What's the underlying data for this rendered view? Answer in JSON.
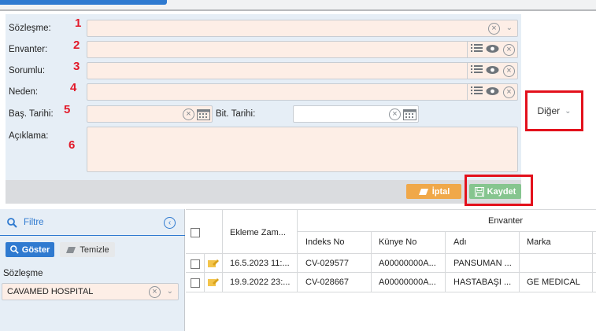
{
  "form": {
    "sozlesme_label": "Sözleşme:",
    "envanter_label": "Envanter:",
    "sorumlu_label": "Sorumlu:",
    "neden_label": "Neden:",
    "bas_tarihi_label": "Baş. Tarihi:",
    "bit_tarihi_label": "Bit. Tarihi:",
    "aciklama_label": "Açıklama:",
    "annotations": [
      "1",
      "2",
      "3",
      "4",
      "5",
      "6"
    ]
  },
  "actions": {
    "iptal_label": "İptal",
    "kaydet_label": "Kaydet"
  },
  "side": {
    "diger_label": "Diğer"
  },
  "filter": {
    "title": "Filtre",
    "goster_label": "Göster",
    "temizle_label": "Temizle",
    "sozlesme_label": "Sözleşme",
    "sozlesme_value": "CAVAMED HOSPITAL"
  },
  "grid": {
    "col_ekleme": "Ekleme Zam...",
    "group_envanter": "Envanter",
    "col_indeks": "Indeks No",
    "col_kunye": "Künye No",
    "col_adi": "Adı",
    "col_marka": "Marka",
    "rows": [
      {
        "ekleme": "16.5.2023 11:...",
        "indeks": "CV-029577",
        "kunye": "A00000000A...",
        "adi": "PANSUMAN ...",
        "marka": ""
      },
      {
        "ekleme": "19.9.2022 23:...",
        "indeks": "CV-028667",
        "kunye": "A00000000A...",
        "adi": "HASTABAŞI ...",
        "marka": "GE MEDICAL"
      }
    ]
  },
  "colors": {
    "accent": "#2f7ad0",
    "field_bg": "#fdeee6",
    "annotation_red": "#e21a2a",
    "iptal": "#f0a849",
    "kaydet": "#86c58f"
  }
}
